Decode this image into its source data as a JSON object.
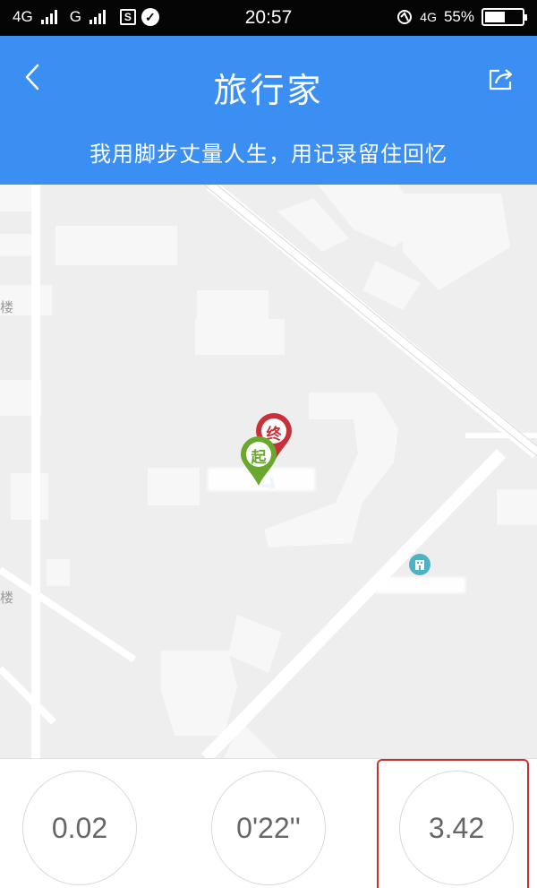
{
  "status_bar": {
    "network1": "4G",
    "network2": "G",
    "s_icon": "S",
    "time": "20:57",
    "network3": "4G",
    "battery": "55%",
    "battery_level": 0.55
  },
  "header": {
    "title": "旅行家",
    "subtitle": "我用脚步丈量人生，用记录留住回忆",
    "color": "#3b8ff3"
  },
  "map": {
    "label_1": "楼",
    "label_2": "楼",
    "start_marker": "起",
    "end_marker": "终",
    "start_color": "#6aa72d",
    "end_color": "#c9313a"
  },
  "stats": {
    "distance": "0.02",
    "duration": "0'22''",
    "pace": "3.42",
    "highlight_color": "#c9312c"
  }
}
